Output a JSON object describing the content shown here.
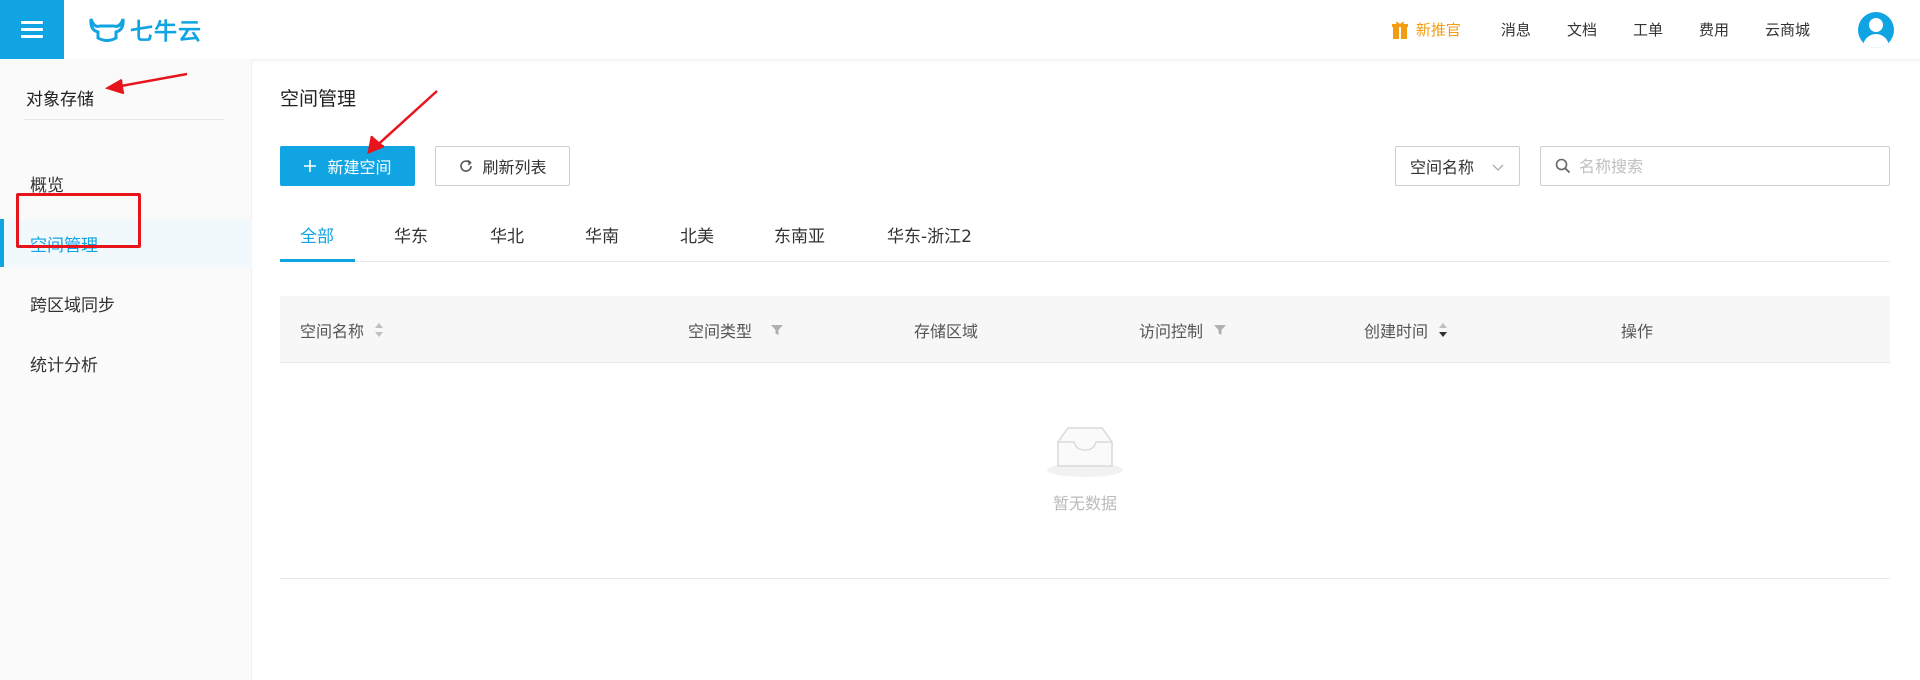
{
  "topbar": {
    "logo_text": "七牛云",
    "promo_label": "新推官",
    "nav": [
      "消息",
      "文档",
      "工单",
      "费用",
      "云商城"
    ],
    "accent_color": "#10a4e3",
    "promo_color": "#f39c12"
  },
  "sidebar": {
    "title": "对象存储",
    "items": [
      {
        "label": "概览",
        "active": false
      },
      {
        "label": "空间管理",
        "active": true
      },
      {
        "label": "跨区域同步",
        "active": false
      },
      {
        "label": "统计分析",
        "active": false
      }
    ]
  },
  "main": {
    "title": "空间管理",
    "create_button": "新建空间",
    "refresh_button": "刷新列表",
    "filter_select": "空间名称",
    "search_placeholder": "名称搜索",
    "tabs": [
      "全部",
      "华东",
      "华北",
      "华南",
      "北美",
      "东南亚",
      "华东-浙江2"
    ],
    "active_tab": "全部",
    "columns": [
      "空间名称",
      "空间类型",
      "存储区域",
      "访问控制",
      "创建时间",
      "操作"
    ],
    "empty_text": "暂无数据"
  },
  "annotations": {
    "highlight_color": "#e8141c"
  }
}
